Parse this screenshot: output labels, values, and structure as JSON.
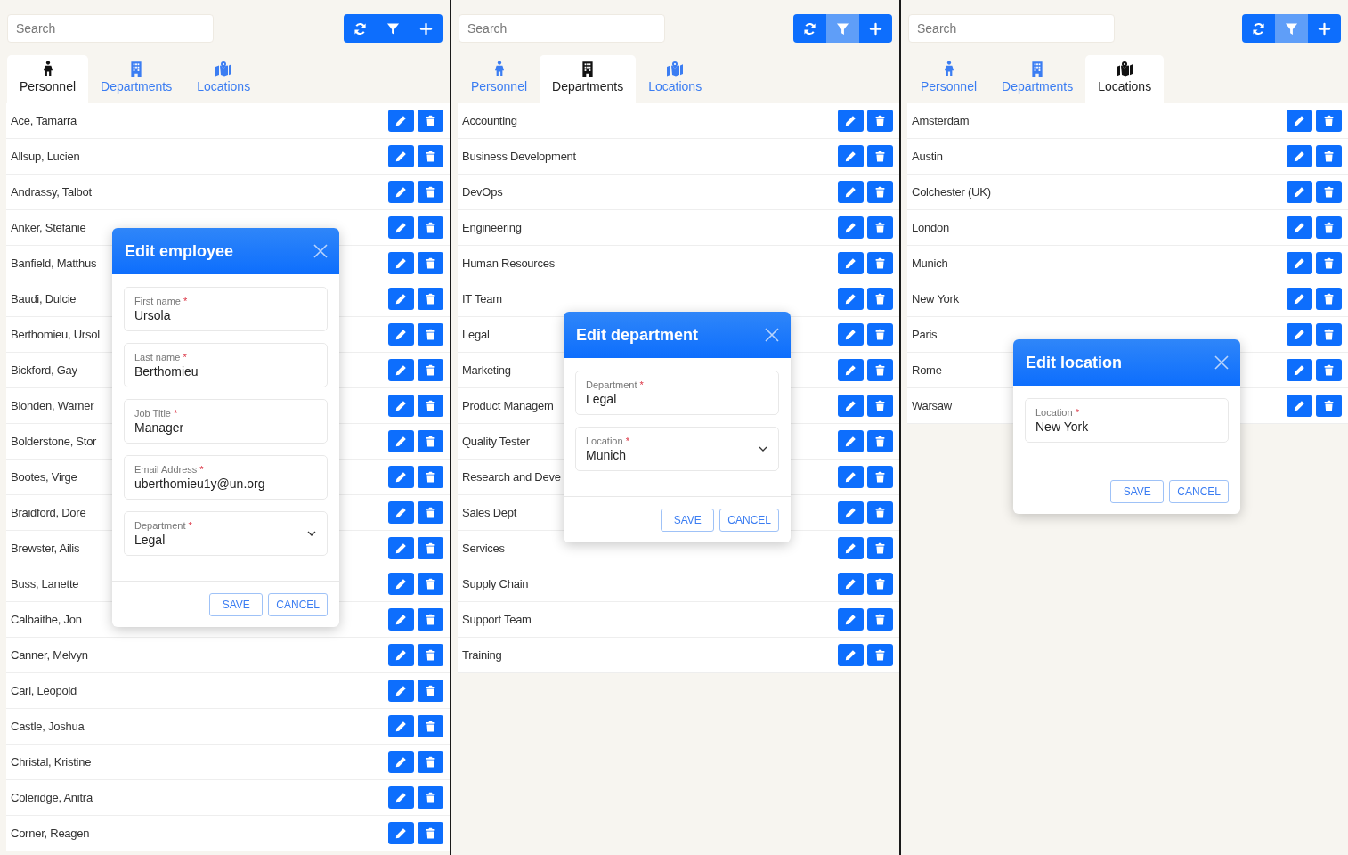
{
  "panels": [
    {
      "search": {
        "placeholder": "Search"
      },
      "toolbar": [
        {
          "kind": "refresh",
          "active": false
        },
        {
          "kind": "filter",
          "active": false
        },
        {
          "kind": "add",
          "active": false
        }
      ],
      "tabs": [
        {
          "kind": "person",
          "label": "Personnel",
          "selected": true
        },
        {
          "kind": "building",
          "label": "Departments",
          "selected": false
        },
        {
          "kind": "map",
          "label": "Locations",
          "selected": false
        }
      ],
      "rows": [
        "Ace, Tamarra",
        "Allsup, Lucien",
        "Andrassy, Talbot",
        "Anker, Stefanie",
        "Banfield, Matthus",
        "Baudi, Dulcie",
        "Berthomieu, Ursol",
        "Bickford, Gay",
        "Blonden, Warner",
        "Bolderstone, Stor",
        "Bootes, Virge",
        "Braidford, Dore",
        "Brewster, Ailis",
        "Buss, Lanette",
        "Calbaithe, Jon",
        "Canner, Melvyn",
        "Carl, Leopold",
        "Castle, Joshua",
        "Christal, Kristine",
        "Coleridge, Anitra",
        "Corner, Reagen"
      ],
      "dialog": {
        "title": "Edit employee",
        "fields": [
          {
            "kind": "text",
            "label": "First name",
            "required_mark": "*",
            "value": "Ursola"
          },
          {
            "kind": "text",
            "label": "Last name",
            "required_mark": "*",
            "value": "Berthomieu"
          },
          {
            "kind": "text",
            "label": "Job Title",
            "required_mark": "*",
            "value": "Manager"
          },
          {
            "kind": "text",
            "label": "Email Address",
            "required_mark": "*",
            "value": "uberthomieu1y@un.org"
          },
          {
            "kind": "select",
            "label": "Department",
            "required_mark": "*",
            "value": "Legal"
          }
        ],
        "buttons": [
          "SAVE",
          "CANCEL"
        ]
      }
    },
    {
      "search": {
        "placeholder": "Search"
      },
      "toolbar": [
        {
          "kind": "refresh",
          "active": false
        },
        {
          "kind": "filter",
          "active": true
        },
        {
          "kind": "add",
          "active": false
        }
      ],
      "tabs": [
        {
          "kind": "person",
          "label": "Personnel",
          "selected": false
        },
        {
          "kind": "building",
          "label": "Departments",
          "selected": true
        },
        {
          "kind": "map",
          "label": "Locations",
          "selected": false
        }
      ],
      "rows": [
        "Accounting",
        "Business Development",
        "DevOps",
        "Engineering",
        "Human Resources",
        "IT Team",
        "Legal",
        "Marketing",
        "Product Managem",
        "Quality Tester",
        "Research and Deve",
        "Sales Dept",
        "Services",
        "Supply Chain",
        "Support Team",
        "Training"
      ],
      "dialog": {
        "title": "Edit department",
        "fields": [
          {
            "kind": "text",
            "label": "Department",
            "required_mark": "*",
            "value": "Legal"
          },
          {
            "kind": "select",
            "label": "Location",
            "required_mark": "*",
            "value": "Munich"
          }
        ],
        "buttons": [
          "SAVE",
          "CANCEL"
        ]
      }
    },
    {
      "search": {
        "placeholder": "Search"
      },
      "toolbar": [
        {
          "kind": "refresh",
          "active": false
        },
        {
          "kind": "filter",
          "active": true
        },
        {
          "kind": "add",
          "active": false
        }
      ],
      "tabs": [
        {
          "kind": "person",
          "label": "Personnel",
          "selected": false
        },
        {
          "kind": "building",
          "label": "Departments",
          "selected": false
        },
        {
          "kind": "map",
          "label": "Locations",
          "selected": true
        }
      ],
      "rows": [
        "Amsterdam",
        "Austin",
        "Colchester (UK)",
        "London",
        "Munich",
        "New York",
        "Paris",
        "Rome",
        "Warsaw"
      ],
      "dialog": {
        "title": "Edit location",
        "fields": [
          {
            "kind": "text",
            "label": "Location",
            "required_mark": "*",
            "value": "New York"
          }
        ],
        "buttons": [
          "SAVE",
          "CANCEL"
        ]
      }
    }
  ]
}
